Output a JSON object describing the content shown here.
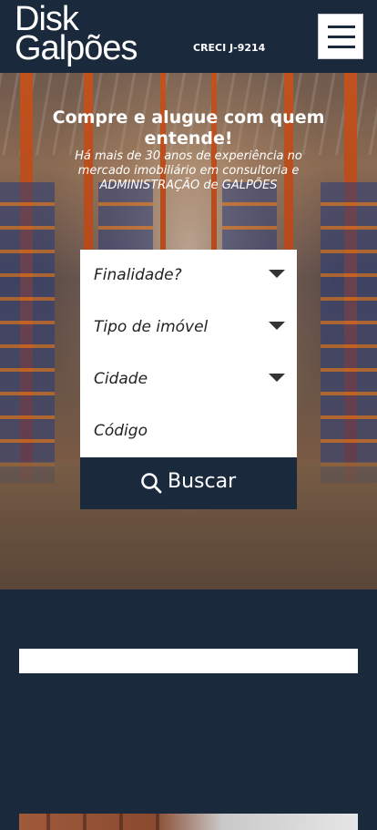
{
  "header": {
    "logo_line1": "Disk",
    "logo_line2": "Galpões",
    "creci": "CRECI J-9214",
    "menu_icon": "hamburger-icon"
  },
  "hero": {
    "headline": "Compre e alugue com quem entende!",
    "subline": "Há mais de 30 anos de experiência no mercado imobiliário em consultoria e ADMINISTRAÇÃO de GALPÕES"
  },
  "search_form": {
    "finalidade": "Finalidade?",
    "tipo_imovel": "Tipo de imóvel",
    "cidade": "Cidade",
    "codigo_placeholder": "Código",
    "button_label": "Buscar",
    "button_icon": "search-icon"
  },
  "colors": {
    "navy": "#1a2a3c",
    "white": "#ffffff"
  }
}
